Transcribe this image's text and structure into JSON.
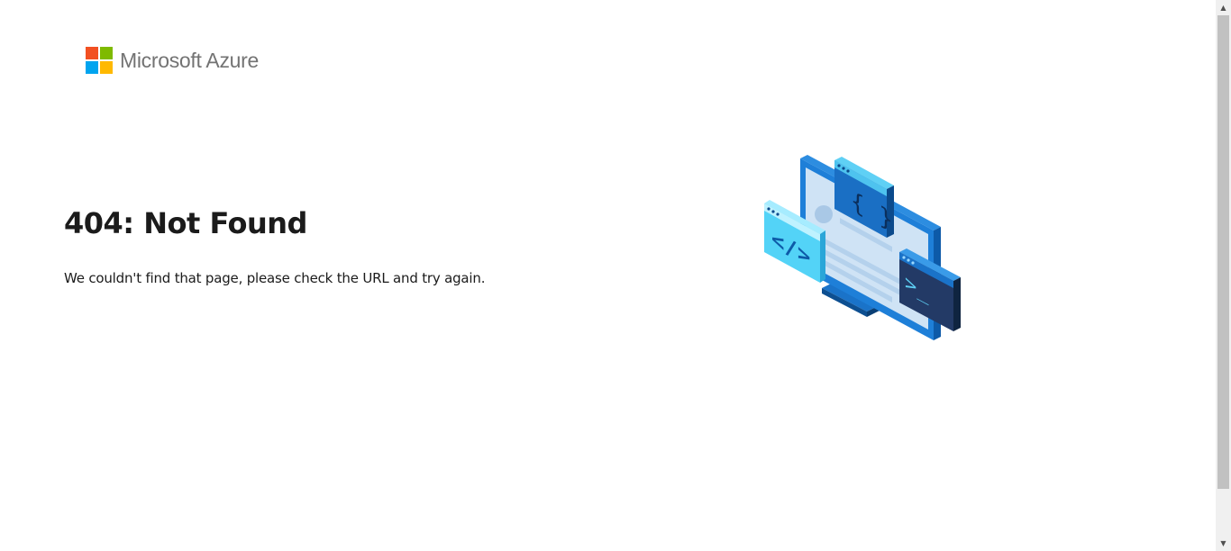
{
  "brand": {
    "name": "Microsoft Azure",
    "logo_colors": [
      "#f25022",
      "#7fba00",
      "#00a4ef",
      "#ffb900"
    ]
  },
  "error": {
    "title": "404: Not Found",
    "message": "We couldn't find that page, please check the URL and try again."
  },
  "illustration": {
    "icon": "developer-monitor-illustration",
    "code_brackets": "{ }",
    "html_tag": "</>",
    "terminal_prompt": ">_"
  },
  "scrollbar": {
    "up_icon": "▲",
    "down_icon": "▼"
  }
}
